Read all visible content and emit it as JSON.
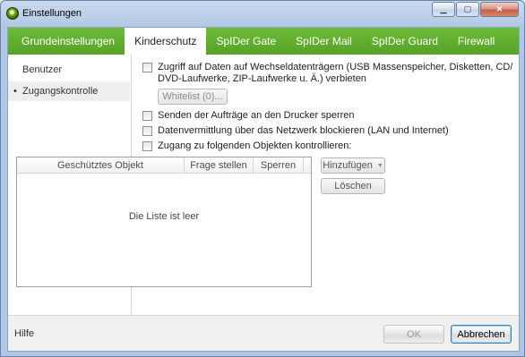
{
  "window": {
    "title": "Einstellungen",
    "caption": {
      "minimize": "▁",
      "maximize": "▢",
      "close": "✕"
    }
  },
  "tabs": [
    {
      "label": "Grundeinstellungen",
      "active": false
    },
    {
      "label": "Kinderschutz",
      "active": true
    },
    {
      "label": "SpIDer Gate",
      "active": false
    },
    {
      "label": "SpIDer Mail",
      "active": false
    },
    {
      "label": "SpIDer Guard",
      "active": false
    },
    {
      "label": "Firewall",
      "active": false
    }
  ],
  "sidebar": {
    "items": [
      {
        "label": "Benutzer",
        "selected": false
      },
      {
        "label": "Zugangskontrolle",
        "selected": true
      }
    ],
    "bullet": "•"
  },
  "options": {
    "removable_media": "Zugriff auf Daten auf Wechseldatenträgern (USB Massenspeicher, Disketten, CD/ DVD-Laufwerke, ZIP-Laufwerke u. Ä.) verbieten",
    "whitelist_button": "Whitelist (0)...",
    "printer": "Senden der Aufträge an den Drucker sperren",
    "network": "Datenvermittlung über das Netzwerk blockieren (LAN und Internet)",
    "objects": "Zugang zu folgenden Objekten kontrollieren:"
  },
  "list": {
    "columns": [
      "Geschütztes Objekt",
      "Frage stellen",
      "Sperren"
    ],
    "empty_text": "Die Liste ist leer",
    "add_button": "Hinzufügen",
    "add_arrow": "▼",
    "delete_button": "Löschen"
  },
  "footer": {
    "help": "Hilfe",
    "ok": "OK",
    "cancel": "Abbrechen"
  },
  "colors": {
    "tab_bar": "#5fac2e",
    "accent_border": "#3c7fb1"
  }
}
